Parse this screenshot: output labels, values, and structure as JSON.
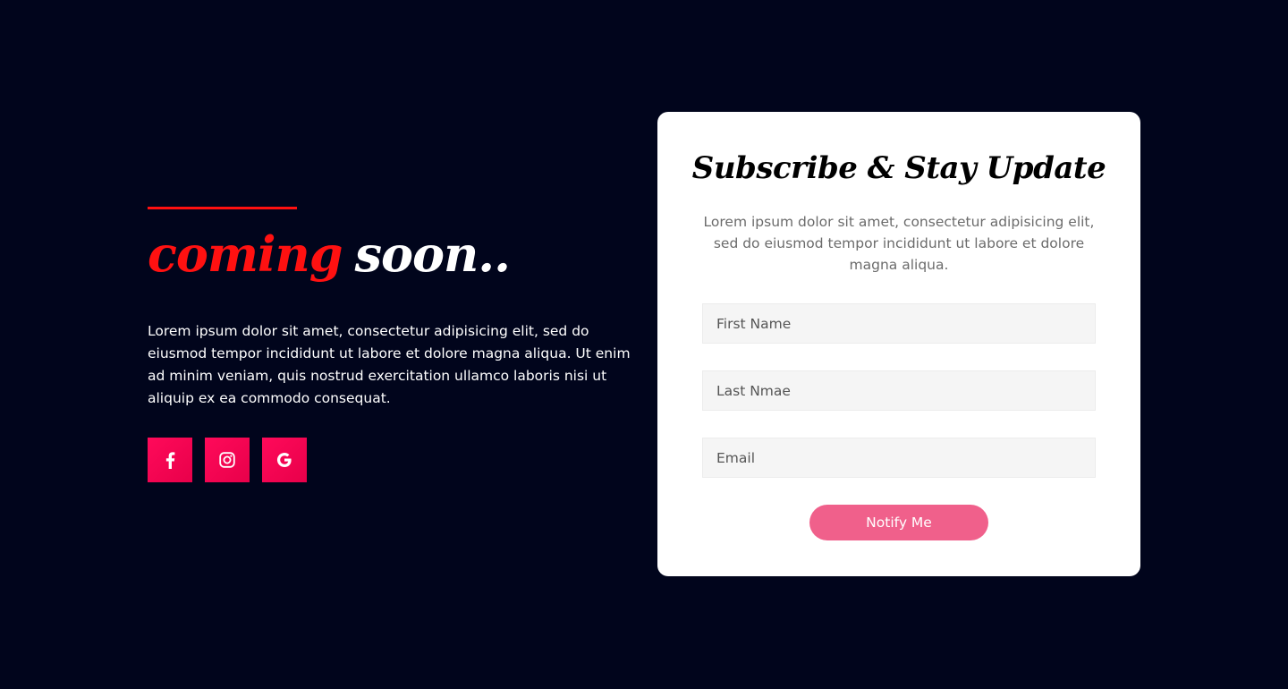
{
  "hero": {
    "heading_word1": "coming",
    "heading_word2": "soon..",
    "intro": "Lorem ipsum dolor sit amet, consectetur adipisicing elit, sed do eiusmod tempor incididunt ut labore et dolore magna aliqua. Ut enim ad minim veniam, quis nostrud exercitation ullamco laboris nisi ut aliquip ex ea commodo consequat.",
    "accent_color": "#ff1111"
  },
  "socials": [
    {
      "name": "facebook",
      "icon": "facebook-icon"
    },
    {
      "name": "instagram",
      "icon": "instagram-icon"
    },
    {
      "name": "google",
      "icon": "google-icon"
    }
  ],
  "card": {
    "title": "Subscribe & Stay Update",
    "description": "Lorem ipsum dolor sit amet, consectetur adipisicing elit, sed do eiusmod tempor incididunt ut labore et dolore magna aliqua.",
    "first_name_placeholder": "First Name",
    "last_name_placeholder": "Last Nmae",
    "email_placeholder": "Email",
    "submit_label": "Notify Me",
    "button_color": "#f0608b"
  },
  "colors": {
    "background": "#01051c",
    "social_button": "#ff0a5a"
  }
}
